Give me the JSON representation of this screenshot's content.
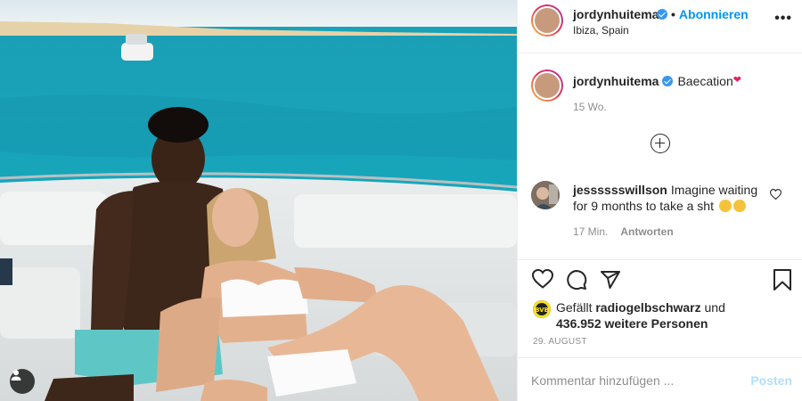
{
  "header": {
    "username": "jordynhuitema",
    "verified": true,
    "follow_label": "Abonnieren",
    "separator": "•",
    "location": "Ibiza, Spain",
    "more_label": "•••"
  },
  "caption": {
    "username": "jordynhuitema",
    "text": "Baecation",
    "emoji": "heart",
    "time": "15 Wo."
  },
  "comments": [
    {
      "username": "jesssssswillson",
      "text": "Imagine waiting for 9 months to take a sht",
      "emojis": [
        "rolling-on-floor-laughing",
        "rolling-on-floor-laughing"
      ],
      "time": "17 Min.",
      "reply_label": "Antworten"
    }
  ],
  "likes": {
    "prefix": "Gefällt",
    "liker": "radiogelbschwarz",
    "conjunction": "und",
    "others": "436.952 weitere Personen"
  },
  "date": "29. AUGUST",
  "add_comment": {
    "placeholder": "Kommentar hinzufügen ...",
    "post_label": "Posten"
  },
  "colors": {
    "accent": "#0095f6",
    "post_disabled": "#b2dffc",
    "muted": "#8e8e8e",
    "text": "#262626",
    "verified": "#3897f0"
  },
  "icons": [
    "more-options-icon",
    "verified-badge-icon",
    "heart-icon",
    "comment-icon",
    "share-icon",
    "bookmark-icon",
    "add-circle-icon",
    "tag-user-icon"
  ]
}
